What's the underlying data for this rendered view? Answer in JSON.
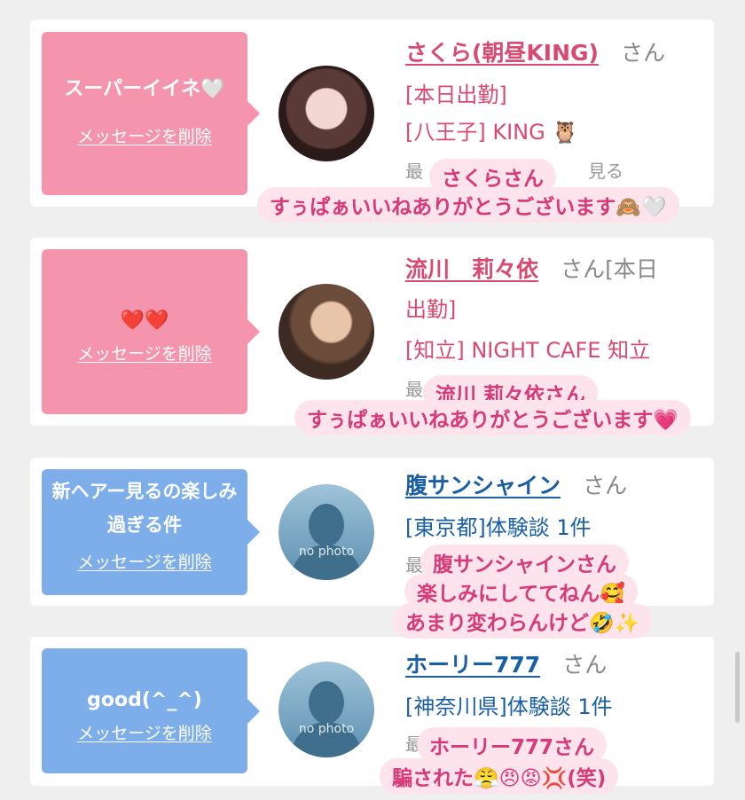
{
  "cards": [
    {
      "message": "スーパーイイネ🤍",
      "delete_label": "メッセージを削除",
      "name": "さくら(朝昼KING)",
      "honorific": "さん",
      "lines": [
        "[本日出勤]",
        "[八王子] KING 🦉"
      ],
      "faint": "最",
      "faint_right": "見る",
      "overlay": [
        "さくらさん",
        "すぅぱぁいいねありがとうございます🙈🤍"
      ]
    },
    {
      "message": "❤️❤️",
      "delete_label": "メッセージを削除",
      "name": "流川　莉々依",
      "honorific": "さん[本日",
      "lines": [
        "出勤]",
        "[知立] NIGHT CAFE 知立"
      ],
      "faint": "最",
      "overlay": [
        "流川 莉々依さん",
        "すぅぱぁいいねありがとうございます💗"
      ]
    },
    {
      "message": "新ヘアー見るの楽しみ過ぎる件",
      "delete_label": "メッセージを削除",
      "name": "腹サンシャイン",
      "honorific": "さん",
      "lines": [
        "[東京都]体験談 1件"
      ],
      "faint": "最",
      "avatar_text": "no photo",
      "overlay": [
        "腹サンシャインさん",
        "楽しみにしててねん🥰",
        "あまり変わらんけど🤣✨"
      ]
    },
    {
      "message": "good(^_^)",
      "delete_label": "メッセージを削除",
      "name": "ホーリー777",
      "honorific": "さん",
      "lines": [
        "[神奈川県]体験談 1件"
      ],
      "faint": "最",
      "avatar_text": "no photo",
      "overlay": [
        "ホーリー777さん",
        "騙された😤😠😡💢(笑)"
      ]
    }
  ]
}
